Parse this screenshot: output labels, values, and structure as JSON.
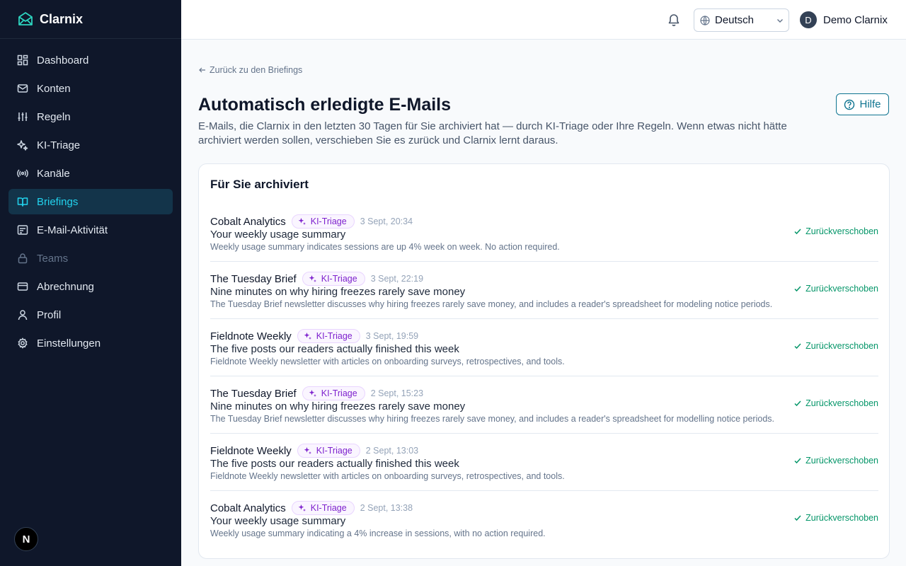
{
  "app": {
    "name": "Clarnix"
  },
  "colors": {
    "sidebar_bg": "#0f172a",
    "accent": "#22d3ee",
    "brand": "#2dd4bf",
    "tag": "#7e22ce",
    "success": "#059669"
  },
  "sidebar": {
    "items": [
      {
        "label": "Dashboard",
        "icon": "dashboard-icon"
      },
      {
        "label": "Konten",
        "icon": "mail-icon"
      },
      {
        "label": "Regeln",
        "icon": "sliders-icon"
      },
      {
        "label": "KI-Triage",
        "icon": "sparkles-icon"
      },
      {
        "label": "Kanäle",
        "icon": "radio-icon"
      },
      {
        "label": "Briefings",
        "icon": "book-open-icon",
        "active": true
      },
      {
        "label": "E-Mail-Aktivität",
        "icon": "activity-icon"
      },
      {
        "label": "Teams",
        "icon": "lock-icon",
        "disabled": true
      },
      {
        "label": "Abrechnung",
        "icon": "credit-card-icon"
      },
      {
        "label": "Profil",
        "icon": "user-icon"
      },
      {
        "label": "Einstellungen",
        "icon": "gear-icon"
      }
    ],
    "footer_badge": "N"
  },
  "header": {
    "language": "Deutsch",
    "user": {
      "initial": "D",
      "name": "Demo Clarnix"
    }
  },
  "main": {
    "back_link": "Zurück zu den Briefings",
    "title": "Automatisch erledigte E-Mails",
    "help_label": "Hilfe",
    "description": "E-Mails, die Clarnix in den letzten 30 Tagen für Sie archiviert hat — durch KI-Triage oder Ihre Regeln. Wenn etwas nicht hätte archiviert werden sollen, verschieben Sie es zurück und Clarnix lernt daraus.",
    "card_title": "Für Sie archiviert",
    "emails": [
      {
        "sender": "Cobalt Analytics",
        "tag": "KI-Triage",
        "time": "3 Sept, 20:34",
        "subject": "Your weekly usage summary",
        "snippet": "Weekly usage summary indicates sessions are up 4% week on week. No action required.",
        "status": "Zurückverschoben"
      },
      {
        "sender": "The Tuesday Brief",
        "tag": "KI-Triage",
        "time": "3 Sept, 22:19",
        "subject": "Nine minutes on why hiring freezes rarely save money",
        "snippet": "The Tuesday Brief newsletter discusses why hiring freezes rarely save money, and includes a reader's spreadsheet for modeling notice periods.",
        "status": "Zurückverschoben"
      },
      {
        "sender": "Fieldnote Weekly",
        "tag": "KI-Triage",
        "time": "3 Sept, 19:59",
        "subject": "The five posts our readers actually finished this week",
        "snippet": "Fieldnote Weekly newsletter with articles on onboarding surveys, retrospectives, and tools.",
        "status": "Zurückverschoben"
      },
      {
        "sender": "The Tuesday Brief",
        "tag": "KI-Triage",
        "time": "2 Sept, 15:23",
        "subject": "Nine minutes on why hiring freezes rarely save money",
        "snippet": "The Tuesday Brief newsletter discusses why hiring freezes rarely save money, and includes a reader's spreadsheet for modelling notice periods.",
        "status": "Zurückverschoben"
      },
      {
        "sender": "Fieldnote Weekly",
        "tag": "KI-Triage",
        "time": "2 Sept, 13:03",
        "subject": "The five posts our readers actually finished this week",
        "snippet": "Fieldnote Weekly newsletter with articles on onboarding surveys, retrospectives, and tools.",
        "status": "Zurückverschoben"
      },
      {
        "sender": "Cobalt Analytics",
        "tag": "KI-Triage",
        "time": "2 Sept, 13:38",
        "subject": "Your weekly usage summary",
        "snippet": "Weekly usage summary indicating a 4% increase in sessions, with no action required.",
        "status": "Zurückverschoben"
      }
    ]
  }
}
